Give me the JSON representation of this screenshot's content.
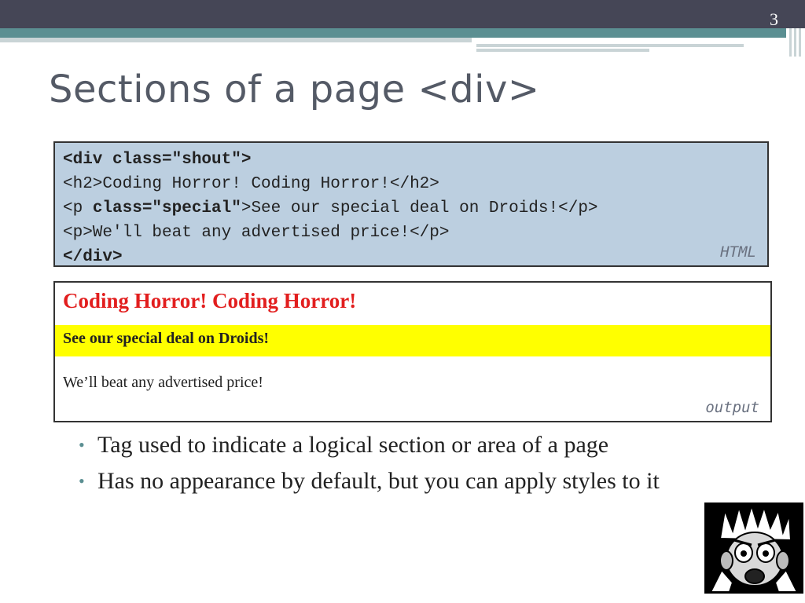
{
  "slide": {
    "number": "3",
    "title": "Sections of a page <div>"
  },
  "code_example": {
    "lines": [
      {
        "tag_open": "<div class=\"shout\">"
      },
      {
        "text": "<h2>Coding Horror! Coding Horror!</h2>"
      },
      {
        "prefix": "<p ",
        "bold": "class=\"special\"",
        "suffix": ">See our special deal on Droids!</p>"
      },
      {
        "text": "<p>We'll beat any advertised price!</p>"
      },
      {
        "tag_close": "</div>"
      }
    ],
    "label": "HTML"
  },
  "output_example": {
    "heading": "Coding Horror! Coding Horror!",
    "special": "See our special deal on Droids!",
    "paragraph": "We’ll beat any advertised price!",
    "label": "output"
  },
  "bullets": [
    "Tag used to indicate a logical section or area of a page",
    "Has no appearance by default, but you can apply styles to it"
  ],
  "colors": {
    "header_bar": "#454656",
    "accent_teal": "#5b8f92",
    "code_bg": "#bccfe0",
    "heading_red": "#e21e1e",
    "highlight_yellow": "#ffff00"
  },
  "image": {
    "icon": "frightened-cartoon-face-icon"
  }
}
